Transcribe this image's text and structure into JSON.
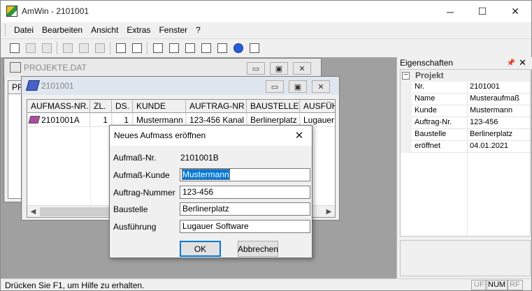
{
  "window": {
    "title": "AmWin - 2101001"
  },
  "menu": [
    "Datei",
    "Bearbeiten",
    "Ansicht",
    "Extras",
    "Fenster",
    "?"
  ],
  "toolbar": {
    "icons": [
      "new-file-icon",
      "open-folder-icon",
      "save-icon",
      "cut-icon",
      "copy-icon",
      "paste-icon",
      "print-icon",
      "print-preview-icon",
      "sort-icon",
      "tree-view-icon",
      "list-view-icon",
      "details-view-icon",
      "table-view-icon",
      "help-icon",
      "context-help-icon"
    ]
  },
  "projekte_window": {
    "title": "PROJEKTE.DAT",
    "first_col": "PF"
  },
  "aufmass_window": {
    "title": "2101001",
    "columns": [
      "AUFMASS-NR.",
      "ZL.",
      "DS.",
      "KUNDE",
      "AUFTRAG-NR",
      "BAUSTELLE",
      "AUSFÜH"
    ],
    "rows": [
      [
        "2101001A",
        "1",
        "1",
        "Mustermann",
        "123-456 Kanal",
        "Berlinerplatz",
        "Lugauer"
      ]
    ]
  },
  "dialog": {
    "title": "Neues Aufmass eröffnen",
    "fields": [
      {
        "label": "Aufmaß-Nr.",
        "value": "2101001B"
      },
      {
        "label": "Aufmaß-Kunde",
        "value": "Mustermann"
      },
      {
        "label": "Auftrag-Nummer",
        "value": "123-456"
      },
      {
        "label": "Baustelle",
        "value": "Berlinerplatz"
      },
      {
        "label": "Ausführung",
        "value": "Lugauer Software"
      }
    ],
    "ok_label": "OK",
    "cancel_label": "Abbrechen"
  },
  "properties": {
    "title": "Eigenschaften",
    "pin": "📌",
    "category": "Projekt",
    "toggle": "−",
    "rows": [
      {
        "key": "Nr.",
        "value": "2101001"
      },
      {
        "key": "Name",
        "value": "Musteraufmaß"
      },
      {
        "key": "Kunde",
        "value": "Mustermann"
      },
      {
        "key": "Auftrag-Nr.",
        "value": "123-456"
      },
      {
        "key": "Baustelle",
        "value": "Berlinerplatz"
      },
      {
        "key": "eröffnet",
        "value": "04.01.2021"
      }
    ]
  },
  "status": {
    "text": "Drücken Sie F1, um Hilfe zu erhalten.",
    "indicators": [
      {
        "label": "UF",
        "active": false
      },
      {
        "label": "NUM",
        "active": true
      },
      {
        "label": "RF",
        "active": false
      }
    ]
  },
  "glyphs": {
    "minimize": "─",
    "maximize": "☐",
    "close": "✕",
    "mdi_min": "▭",
    "mdi_max": "▣",
    "mdi_close": "✕",
    "arrow_left": "◀",
    "arrow_right": "▶"
  }
}
